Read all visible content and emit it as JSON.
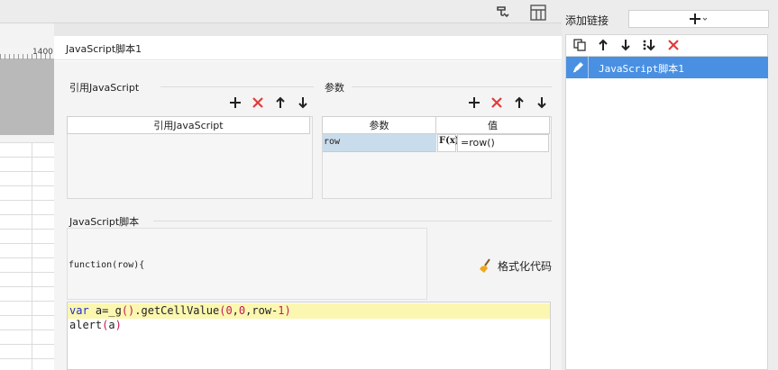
{
  "ruler": {
    "label": "1400"
  },
  "dialog": {
    "title": "JavaScript脚本1"
  },
  "ref_section": {
    "label": "引用JavaScript",
    "column": "引用JavaScript"
  },
  "param_section": {
    "label": "参数",
    "columns": [
      "参数",
      "值"
    ],
    "rows": [
      {
        "name": "row",
        "formula_icon": "F(x)",
        "value": "=row()"
      }
    ]
  },
  "script_section": {
    "label": "JavaScript脚本",
    "func_signature": "function(row){",
    "format_button": "格式化代码",
    "code_lines": [
      "var a=_g().getCellValue(0,0,row-1)",
      "alert(a)"
    ]
  },
  "right_panel": {
    "add_link_label": "添加链接",
    "items": [
      {
        "label": "JavaScript脚本1",
        "selected": true
      }
    ]
  },
  "colors": {
    "selection": "#4a90e2",
    "delete_red": "#e23b3b",
    "highlight": "#fbf7b0"
  },
  "icons": [
    "add-icon",
    "delete-icon",
    "move-up-icon",
    "move-down-icon",
    "copy-icon",
    "move-bottom-icon",
    "edit-icon",
    "broom-icon",
    "formula-icon"
  ]
}
